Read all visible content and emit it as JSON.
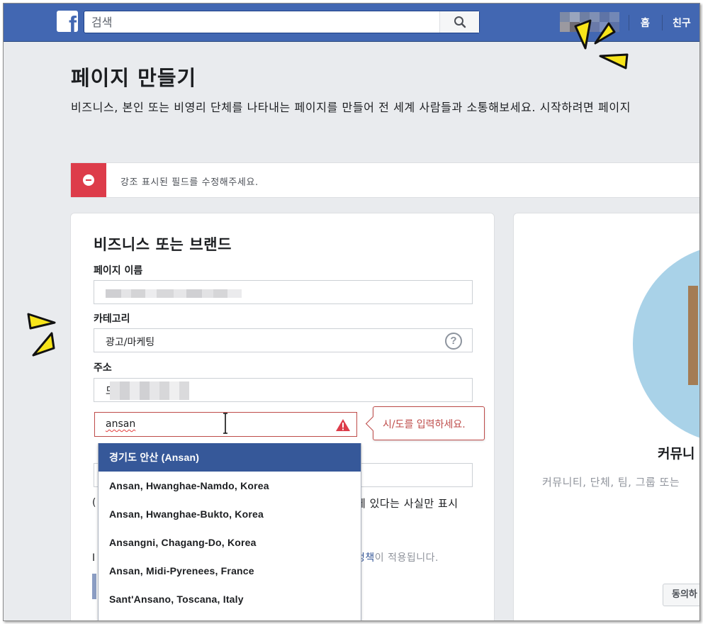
{
  "topbar": {
    "logo": "f",
    "search_placeholder": "검색",
    "nav": [
      "홈",
      "친구"
    ]
  },
  "page": {
    "title": "페이지 만들기",
    "description": "비즈니스, 본인 또는 비영리 단체를 나타내는 페이지를 만들어 전 세계 사람들과 소통해보세요. 시작하려면 페이지"
  },
  "error_banner": {
    "message": "강조 표시된 필드를 수정해주세요."
  },
  "business_card": {
    "title": "비즈니스 또는 브랜드",
    "page_name_label": "페이지 이름",
    "category_label": "카테고리",
    "category_value": "광고/마케팅",
    "help_icon": "?",
    "address_label": "주소",
    "address_prefix": "드",
    "city_value": "ansan",
    "city_error": "시/도를 입력하세요.",
    "behind_text_1": "에 있다는 사실만 표시",
    "behind_text_2_link": "정책",
    "behind_text_2_rest": "이 적용됩니다."
  },
  "city_suggestions": [
    "경기도 안산 (Ansan)",
    "Ansan, Hwanghae-Namdo, Korea",
    "Ansan, Hwanghae-Bukto, Korea",
    "Ansangni, Chagang-Do, Korea",
    "Ansan, Midi-Pyrenees, France",
    "Sant'Ansano, Toscana, Italy"
  ],
  "community_card": {
    "title": "커뮤니",
    "description": "커뮤니티, 단체, 팀, 그룹 또는",
    "button": "동의하"
  },
  "colors": {
    "facebook_blue": "#4267b2",
    "error_red": "#be4b49",
    "selected_blue": "#365899",
    "annotation_yellow": "#f7e41a"
  }
}
